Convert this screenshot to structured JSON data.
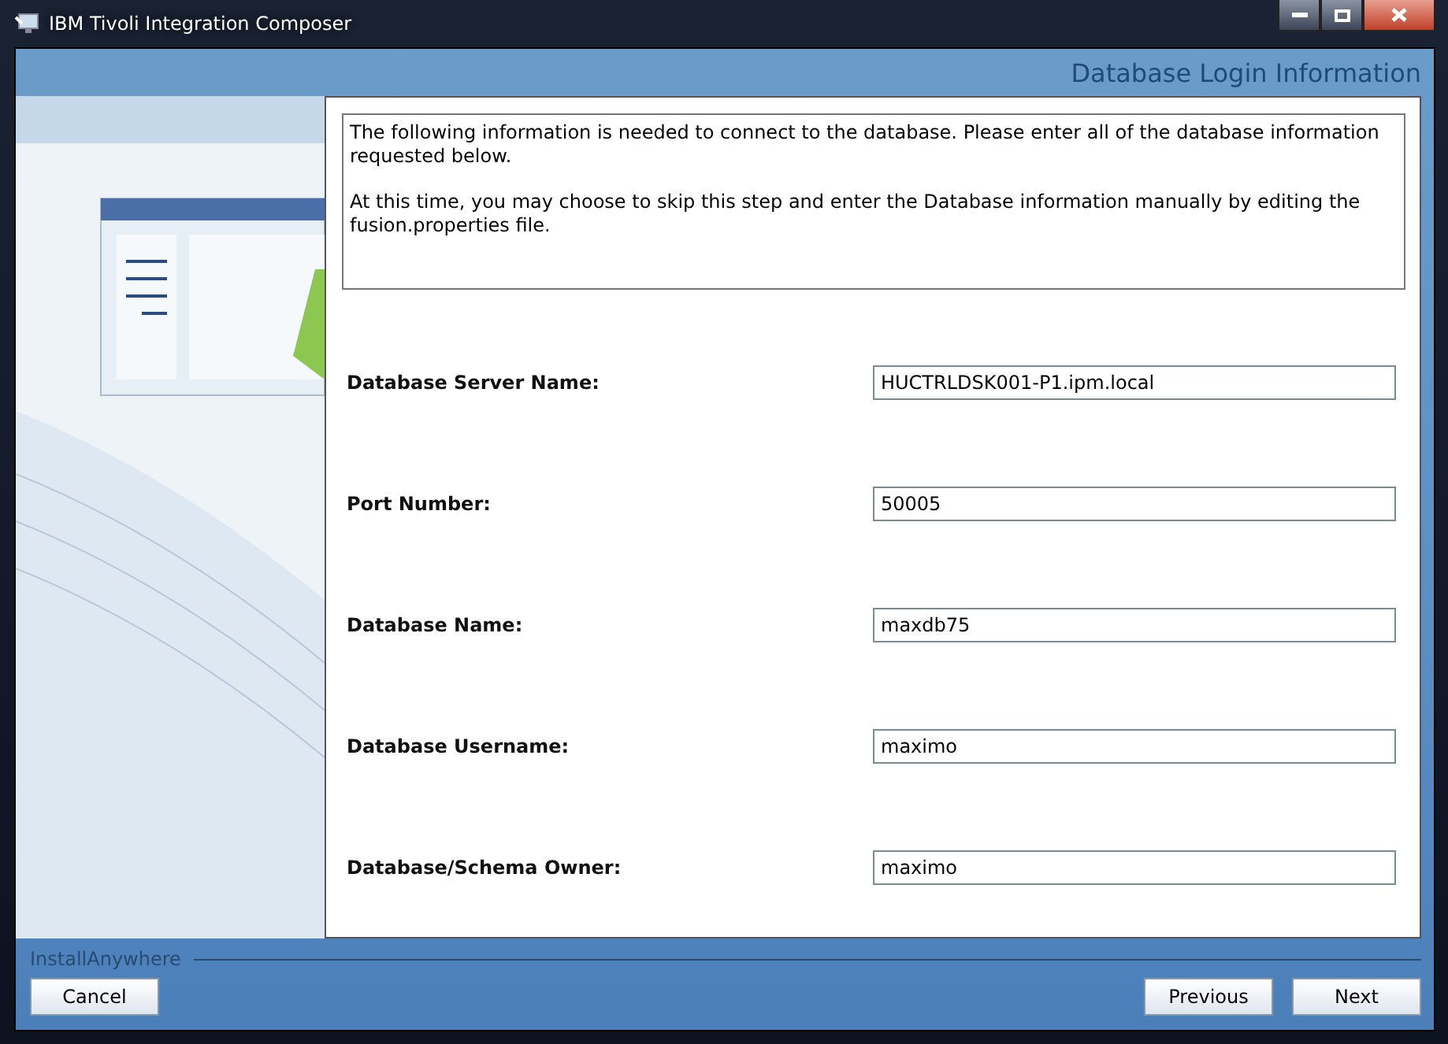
{
  "window": {
    "title": "IBM Tivoli Integration Composer"
  },
  "header": {
    "title": "Database Login Information"
  },
  "intro": [
    "The following information is needed to connect to the database. Please enter all of the database information requested below.",
    "At this time, you may choose to skip this step and enter the Database information manually by editing the fusion.properties file."
  ],
  "fields": [
    {
      "label": "Database Server Name:",
      "value": "HUCTRLDSK001-P1.ipm.local"
    },
    {
      "label": "Port Number:",
      "value": "50005"
    },
    {
      "label": "Database Name:",
      "value": "maxdb75"
    },
    {
      "label": "Database Username:",
      "value": "maximo"
    },
    {
      "label": "Database/Schema Owner:",
      "value": "maximo"
    }
  ],
  "footer": {
    "brand": "InstallAnywhere",
    "cancel": "Cancel",
    "previous": "Previous",
    "next": "Next"
  }
}
